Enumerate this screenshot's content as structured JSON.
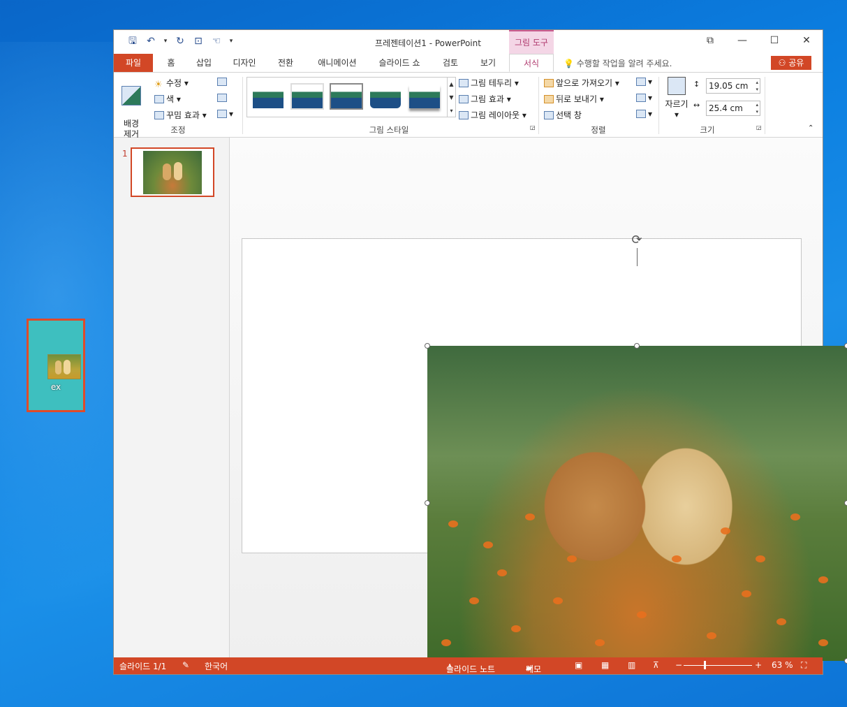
{
  "desktop": {
    "icon_label": "ex"
  },
  "window": {
    "title": "프레젠테이션1 - PowerPoint",
    "context_tab": "그림 도구",
    "controls": {
      "restore": "⧉",
      "minimize": "—",
      "maximize": "☐",
      "close": "✕"
    }
  },
  "qat": {
    "save": "🖫",
    "undo": "↶",
    "undo_drop": "▾",
    "redo": "↻",
    "present": "⊡",
    "touch": "☜",
    "customize": "▾"
  },
  "tabs": [
    "파일",
    "홈",
    "삽입",
    "디자인",
    "전환",
    "애니메이션",
    "슬라이드 쇼",
    "검토",
    "보기",
    "서식"
  ],
  "active_tab": "서식",
  "tell_me": "수행할 작업을 알려 주세요.",
  "share_label": "공유",
  "ribbon": {
    "adjust": {
      "remove_bg": "배경\n제거",
      "corrections": "수정 ▾",
      "color": "색 ▾",
      "artistic": "꾸밈 효과 ▾",
      "group_label": "조정"
    },
    "styles": {
      "border": "그림 테두리 ▾",
      "effects": "그림 효과 ▾",
      "layout": "그림 레이아웃 ▾",
      "group_label": "그림 스타일"
    },
    "arrange": {
      "bring_forward": "앞으로 가져오기 ▾",
      "send_backward": "뒤로 보내기 ▾",
      "selection_pane": "선택 창",
      "group_label": "정렬"
    },
    "size": {
      "crop": "자르기",
      "height": "19.05 cm",
      "width": "25.4 cm",
      "group_label": "크기"
    }
  },
  "slides_pane": {
    "slide_number": "1"
  },
  "status": {
    "slide": "슬라이드 1/1",
    "language": "한국어",
    "notes": "슬라이드 노트",
    "comments": "메모",
    "zoom": "63 %"
  },
  "colors": {
    "accent": "#d24726",
    "context": "#b03a6e"
  }
}
